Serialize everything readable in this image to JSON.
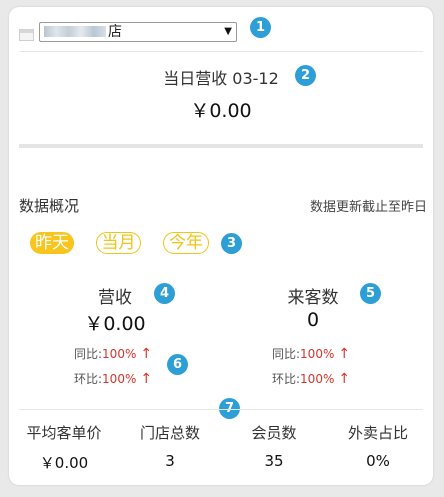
{
  "header": {
    "store_name": "店",
    "store_icon": "store-icon"
  },
  "daily": {
    "title": "当日营收",
    "date": "03-12",
    "amount": "￥0.00"
  },
  "overview": {
    "title": "数据概况",
    "note": "数据更新截止至昨日",
    "tabs": [
      "昨天",
      "当月",
      "今年"
    ],
    "active_tab": "昨天",
    "revenue": {
      "label": "营收",
      "value": "￥0.00",
      "yoy_label": "同比:",
      "yoy_value": "100%",
      "mom_label": "环比:",
      "mom_value": "100%"
    },
    "visitors": {
      "label": "来客数",
      "value": "0",
      "yoy_label": "同比:",
      "yoy_value": "100%",
      "mom_label": "环比:",
      "mom_value": "100%"
    }
  },
  "stats": [
    {
      "label": "平均客单价",
      "value": "￥0.00"
    },
    {
      "label": "门店总数",
      "value": "3"
    },
    {
      "label": "会员数",
      "value": "35"
    },
    {
      "label": "外卖占比",
      "value": "0%"
    }
  ],
  "arrow_glyph": "↑",
  "badges": [
    "1",
    "2",
    "3",
    "4",
    "5",
    "6",
    "7"
  ],
  "colors": {
    "badge": "#2e9fd6",
    "tab_active": "#f7c51e",
    "tab_border": "#f0c419",
    "increase": "#d9342b"
  }
}
